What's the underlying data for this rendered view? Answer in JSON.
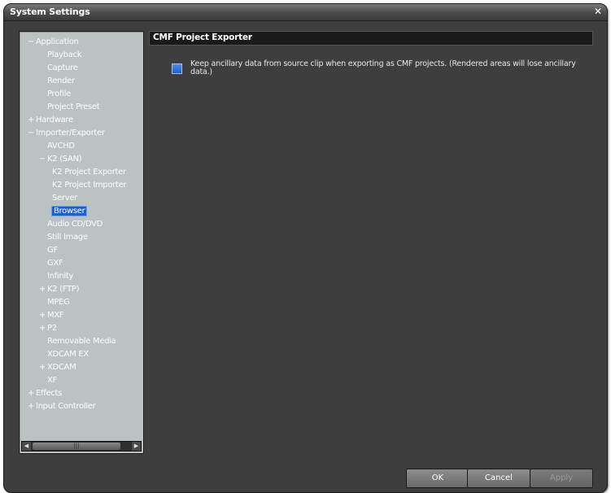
{
  "window": {
    "title": "System Settings",
    "close_glyph": "✕"
  },
  "tree": {
    "items": [
      {
        "label": "Application",
        "toggle": "−",
        "level": 0
      },
      {
        "label": "Playback",
        "toggle": "",
        "level": 1
      },
      {
        "label": "Capture",
        "toggle": "",
        "level": 1
      },
      {
        "label": "Render",
        "toggle": "",
        "level": 1
      },
      {
        "label": "Profile",
        "toggle": "",
        "level": 1
      },
      {
        "label": "Project Preset",
        "toggle": "",
        "level": 1
      },
      {
        "label": "Hardware",
        "toggle": "+",
        "level": 0
      },
      {
        "label": "Importer/Exporter",
        "toggle": "−",
        "level": 0
      },
      {
        "label": "AVCHD",
        "toggle": "",
        "level": 1
      },
      {
        "label": "K2 (SAN)",
        "toggle": "−",
        "level": 1
      },
      {
        "label": "K2 Project Exporter",
        "toggle": "",
        "level": 2
      },
      {
        "label": "K2 Project Importer",
        "toggle": "",
        "level": 2
      },
      {
        "label": "Server",
        "toggle": "",
        "level": 2
      },
      {
        "label": "Browser",
        "toggle": "",
        "level": 2,
        "selected": true
      },
      {
        "label": "Audio CD/DVD",
        "toggle": "",
        "level": 1
      },
      {
        "label": "Still Image",
        "toggle": "",
        "level": 1
      },
      {
        "label": "GF",
        "toggle": "",
        "level": 1
      },
      {
        "label": "GXF",
        "toggle": "",
        "level": 1
      },
      {
        "label": "Infinity",
        "toggle": "",
        "level": 1
      },
      {
        "label": "K2 (FTP)",
        "toggle": "+",
        "level": 1
      },
      {
        "label": "MPEG",
        "toggle": "",
        "level": 1
      },
      {
        "label": "MXF",
        "toggle": "+",
        "level": 1
      },
      {
        "label": "P2",
        "toggle": "+",
        "level": 1
      },
      {
        "label": "Removable Media",
        "toggle": "",
        "level": 1
      },
      {
        "label": "XDCAM EX",
        "toggle": "",
        "level": 1
      },
      {
        "label": "XDCAM",
        "toggle": "+",
        "level": 1
      },
      {
        "label": "XF",
        "toggle": "",
        "level": 1
      },
      {
        "label": "Effects",
        "toggle": "+",
        "level": 0
      },
      {
        "label": "Input Controller",
        "toggle": "+",
        "level": 0
      }
    ],
    "scroll_left_glyph": "◀",
    "scroll_right_glyph": "▶",
    "scroll_grip_glyph": "|||"
  },
  "content": {
    "section_title": "CMF Project Exporter",
    "option_label": "Keep ancillary data from source clip when exporting as CMF projects. (Rendered areas will lose ancillary data.)",
    "option_checked": true
  },
  "buttons": {
    "ok": "OK",
    "cancel": "Cancel",
    "apply": "Apply"
  },
  "colors": {
    "selection": "#1e5fc8",
    "checkbox": "#2f74d6"
  }
}
